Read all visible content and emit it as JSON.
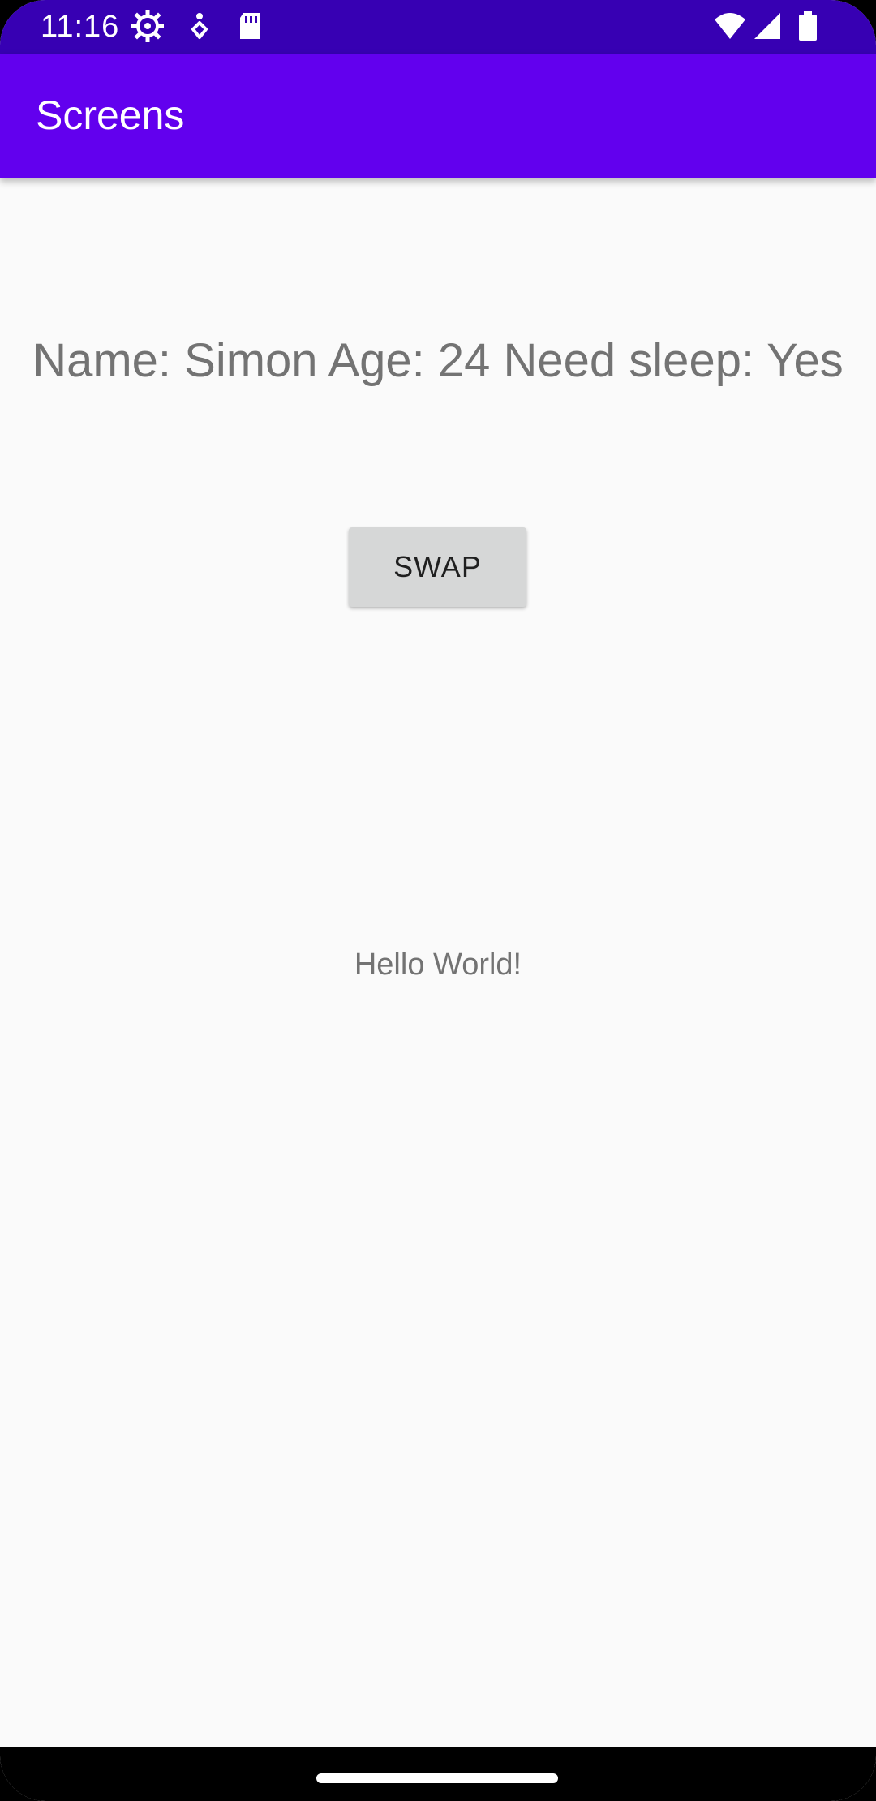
{
  "status_bar": {
    "time": "11:16",
    "icons": [
      "settings-icon",
      "accessibility-icon",
      "sd-card-icon",
      "wifi-icon",
      "signal-icon",
      "battery-icon"
    ]
  },
  "app_bar": {
    "title": "Screens"
  },
  "main": {
    "info_text": "Name: Simon Age: 24 Need sleep: Yes",
    "swap_button_label": "SWAP",
    "hello_text": "Hello World!"
  },
  "colors": {
    "status_bar": "#3700b3",
    "app_bar": "#6200ee",
    "background": "#fafafa",
    "button": "#d6d7d7",
    "text_secondary": "#737373"
  }
}
